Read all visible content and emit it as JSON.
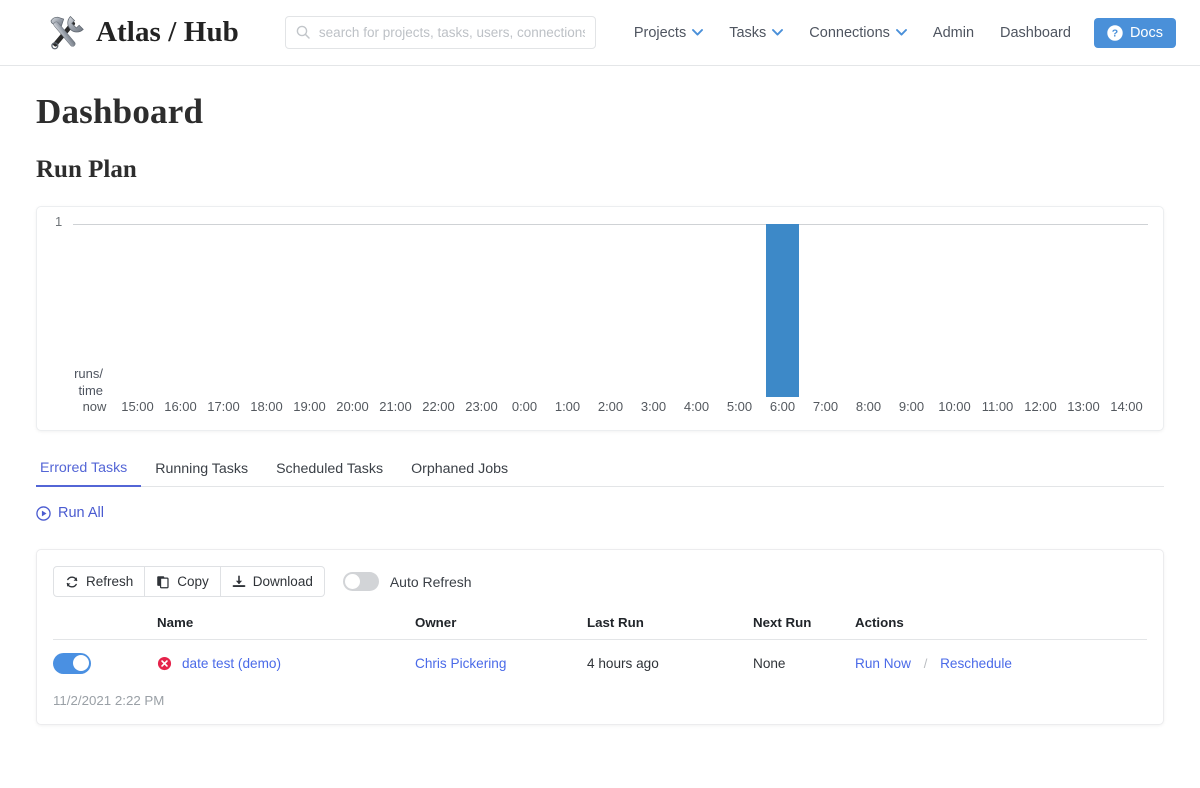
{
  "navbar": {
    "brand": "Atlas / Hub",
    "logo_icon": "hammer-wrench-icon",
    "search": {
      "placeholder": "search for projects, tasks, users, connections ..",
      "value": "",
      "icon": "search-icon"
    },
    "links": [
      {
        "label": "Projects",
        "has_caret": true
      },
      {
        "label": "Tasks",
        "has_caret": true
      },
      {
        "label": "Connections",
        "has_caret": true
      },
      {
        "label": "Admin",
        "has_caret": false
      },
      {
        "label": "Dashboard",
        "has_caret": false
      }
    ],
    "docs_button": {
      "label": "Docs",
      "icon": "question-circle-icon",
      "color": "#4a90d9"
    }
  },
  "page": {
    "title": "Dashboard",
    "section_title": "Run Plan"
  },
  "chart_data": {
    "type": "bar",
    "title": "Run Plan",
    "xlabel": "",
    "ylabel": "runs/ time",
    "ylabel_lines": [
      "runs/",
      "time"
    ],
    "categories": [
      "now",
      "15:00",
      "16:00",
      "17:00",
      "18:00",
      "19:00",
      "20:00",
      "21:00",
      "22:00",
      "23:00",
      "0:00",
      "1:00",
      "2:00",
      "3:00",
      "4:00",
      "5:00",
      "6:00",
      "7:00",
      "8:00",
      "9:00",
      "10:00",
      "11:00",
      "12:00",
      "13:00",
      "14:00"
    ],
    "values": [
      0,
      0,
      0,
      0,
      0,
      0,
      0,
      0,
      0,
      0,
      0,
      0,
      0,
      0,
      0,
      0,
      1,
      0,
      0,
      0,
      0,
      0,
      0,
      0,
      0
    ],
    "ylim": [
      0,
      1
    ],
    "ytick_labels": [
      "1"
    ],
    "grid": true,
    "bar_color": "#3d89c8",
    "legend": "none"
  },
  "tabs": [
    {
      "label": "Errored Tasks",
      "active": true
    },
    {
      "label": "Running Tasks",
      "active": false
    },
    {
      "label": "Scheduled Tasks",
      "active": false
    },
    {
      "label": "Orphaned Jobs",
      "active": false
    }
  ],
  "run_all": {
    "label": "Run All",
    "icon": "play-circle-icon"
  },
  "toolbar": {
    "refresh_label": "Refresh",
    "copy_label": "Copy",
    "download_label": "Download",
    "auto_refresh_label": "Auto Refresh",
    "auto_refresh_on": false
  },
  "table": {
    "columns": [
      "Name",
      "Owner",
      "Last Run",
      "Next Run",
      "Actions"
    ],
    "rows": [
      {
        "enabled": true,
        "status_icon": "error-circle-icon",
        "name": "date test (demo)",
        "owner": "Chris Pickering",
        "last_run": "4 hours ago",
        "next_run": "None",
        "actions": {
          "run_now": "Run Now",
          "separator": "/",
          "reschedule": "Reschedule"
        }
      }
    ]
  },
  "footer": {
    "timestamp": "11/2/2021 2:22 PM"
  }
}
